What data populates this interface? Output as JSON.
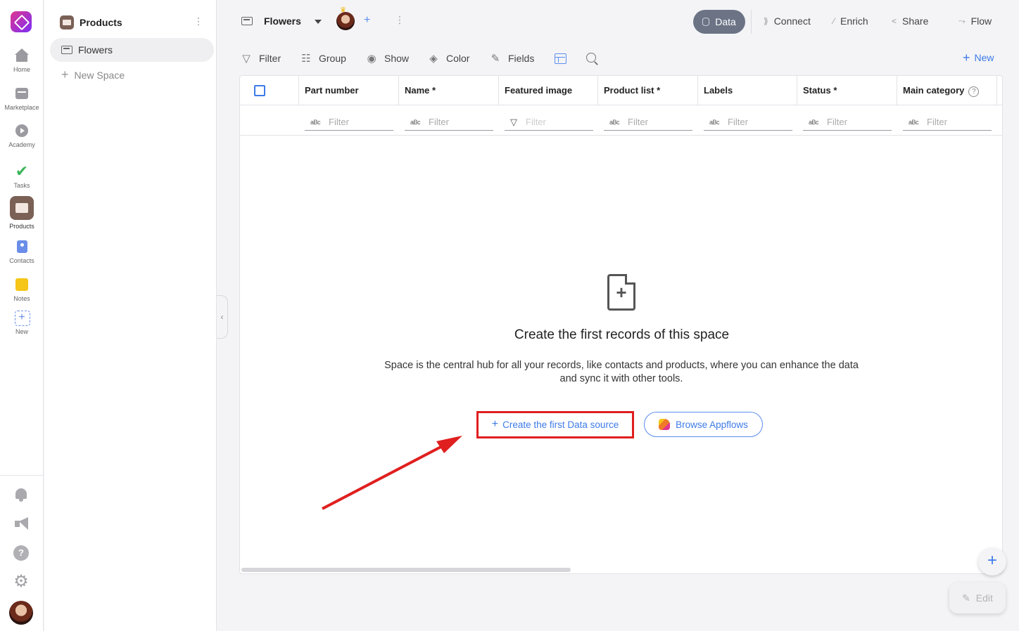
{
  "rail": {
    "items": [
      {
        "label": "Home",
        "icon": "home-icon"
      },
      {
        "label": "Marketplace",
        "icon": "marketplace-icon"
      },
      {
        "label": "Academy",
        "icon": "play-icon"
      },
      {
        "label": "Tasks",
        "icon": "check-icon"
      },
      {
        "label": "Products",
        "icon": "products-icon"
      },
      {
        "label": "Contacts",
        "icon": "contacts-icon"
      },
      {
        "label": "Notes",
        "icon": "notes-icon"
      },
      {
        "label": "New",
        "icon": "add-app-icon"
      }
    ],
    "help_glyph": "?",
    "gear_glyph": "⚙"
  },
  "panel": {
    "title": "Products",
    "dots": "⋮",
    "spaces": [
      {
        "label": "Flowers"
      }
    ],
    "new_space_label": "New Space"
  },
  "topbar": {
    "space_name": "Flowers",
    "dots": "⋮",
    "plus": "+",
    "data_label": "Data",
    "connect_label": "Connect",
    "enrich_label": "Enrich",
    "share_label": "Share",
    "flow_label": "Flow"
  },
  "toolbar": {
    "filter_label": "Filter",
    "group_label": "Group",
    "show_label": "Show",
    "color_label": "Color",
    "fields_label": "Fields",
    "new_label": "New"
  },
  "table": {
    "columns": [
      {
        "label": "Part number"
      },
      {
        "label": "Name *"
      },
      {
        "label": "Featured image"
      },
      {
        "label": "Product list *"
      },
      {
        "label": "Labels"
      },
      {
        "label": "Status *"
      },
      {
        "label": "Main category"
      }
    ],
    "filter_placeholder": "Filter",
    "text_type_glyph": "aBc"
  },
  "empty_state": {
    "title": "Create the first records of this space",
    "description": "Space is the central hub for all your records, like contacts and products, where you can enhance the data and sync it with other tools.",
    "create_label": "Create the first Data source",
    "browse_label": "Browse Appflows"
  },
  "fab": {
    "plus": "+"
  },
  "edit_label": "Edit",
  "colors": {
    "accent": "#3d7be8",
    "highlight": "#e01f1f",
    "data_pill": "#6b7385"
  }
}
